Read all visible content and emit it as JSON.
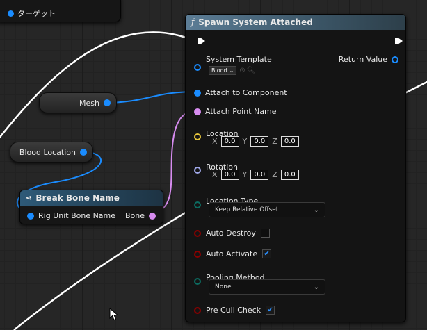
{
  "top_node": {
    "label": "ターゲット"
  },
  "mesh_node": {
    "label": "Mesh"
  },
  "blood_location_node": {
    "label": "Blood Location"
  },
  "break_bone_node": {
    "title": "Break Bone Name",
    "input_label": "Rig Unit Bone Name",
    "output_label": "Bone"
  },
  "spawn_node": {
    "title": "Spawn System Attached",
    "function_icon": "ƒ",
    "return_value": "Return Value",
    "system_template": {
      "label": "System Template",
      "value": "Blood"
    },
    "attach_to_component": "Attach to Component",
    "attach_point_name": "Attach Point Name",
    "location": {
      "label": "Location",
      "x": "0.0",
      "y": "0.0",
      "z": "0.0"
    },
    "rotation": {
      "label": "Rotation",
      "x": "0.0",
      "y": "0.0",
      "z": "0.0"
    },
    "axis_x": "X",
    "axis_y": "Y",
    "axis_z": "Z",
    "location_type": {
      "label": "Location Type",
      "value": "Keep Relative Offset"
    },
    "auto_destroy": {
      "label": "Auto Destroy",
      "checked": false
    },
    "auto_activate": {
      "label": "Auto Activate",
      "checked": true
    },
    "pooling_method": {
      "label": "Pooling Method",
      "value": "None"
    },
    "pre_cull_check": {
      "label": "Pre Cull Check",
      "checked": true
    }
  },
  "colors": {
    "object_pin": "#1a8cff",
    "name_pin": "#d78cf0",
    "vector_pin": "#e5c43b",
    "rotator_pin": "#a0a8e8",
    "enum_pin": "#0c6b60",
    "bool_pin": "#8b0000",
    "header": "#3b5566"
  }
}
